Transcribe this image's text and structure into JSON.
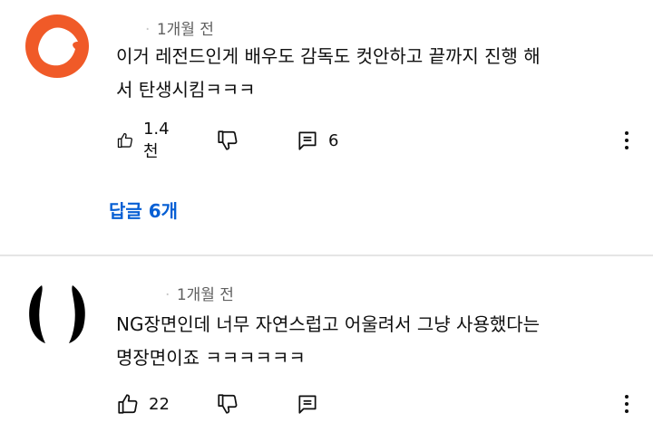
{
  "comments": [
    {
      "time": "1개월 전",
      "text": "이거 레전드인게 배우도 감독도 컷안하고 끝까지 진행 해\n서 탄생시킴ㅋㅋㅋ",
      "likes": "1.4천",
      "reply_count": "6",
      "replies_link": "답글 6개",
      "avatar_color": "#f05a28"
    },
    {
      "time": "1개월 전",
      "text": "NG장면인데 너무 자연스럽고 어울려서 그냥 사용했다는\n명장면이죠 ㅋㅋㅋㅋㅋㅋ",
      "likes": "22",
      "avatar_color": "#000000"
    }
  ],
  "icons": {
    "like": "thumbs-up-icon",
    "dislike": "thumbs-down-icon",
    "reply": "reply-icon",
    "more": "more-vert-icon"
  },
  "colors": {
    "link": "#065fd4",
    "meta": "#606060"
  }
}
